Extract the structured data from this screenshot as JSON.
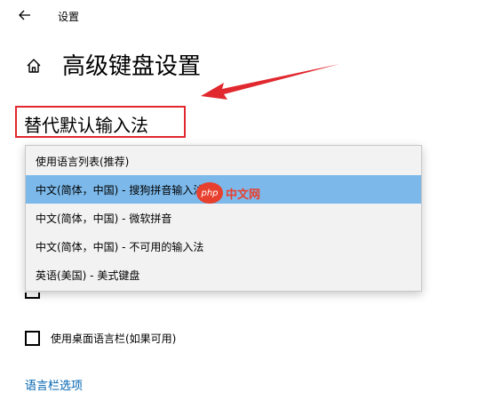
{
  "window": {
    "title": "设置"
  },
  "page": {
    "title": "高级键盘设置"
  },
  "section": {
    "title": "替代默认输入法"
  },
  "dropdown": {
    "options": [
      {
        "label": "使用语言列表(推荐)",
        "selected": false
      },
      {
        "label": "中文(简体，中国) - 搜狗拼音输入法",
        "selected": true
      },
      {
        "label": "中文(简体，中国) - 微软拼音",
        "selected": false
      },
      {
        "label": "中文(简体，中国) - 不可用的输入法",
        "selected": false
      },
      {
        "label": "英语(美国) - 美式键盘",
        "selected": false
      }
    ]
  },
  "checkboxes": {
    "desktop_language_bar": {
      "label": "使用桌面语言栏(如果可用)",
      "checked": false
    }
  },
  "links": {
    "language_bar_options": "语言栏选项"
  },
  "watermark": {
    "logo": "php",
    "text": "中文网"
  },
  "colors": {
    "highlight_border": "#e0282e",
    "selected_item": "#7cb9ea",
    "link": "#0063b1",
    "annotation_arrow": "#e0282e"
  },
  "icons": {
    "back": "back-arrow-icon",
    "home": "home-icon"
  }
}
